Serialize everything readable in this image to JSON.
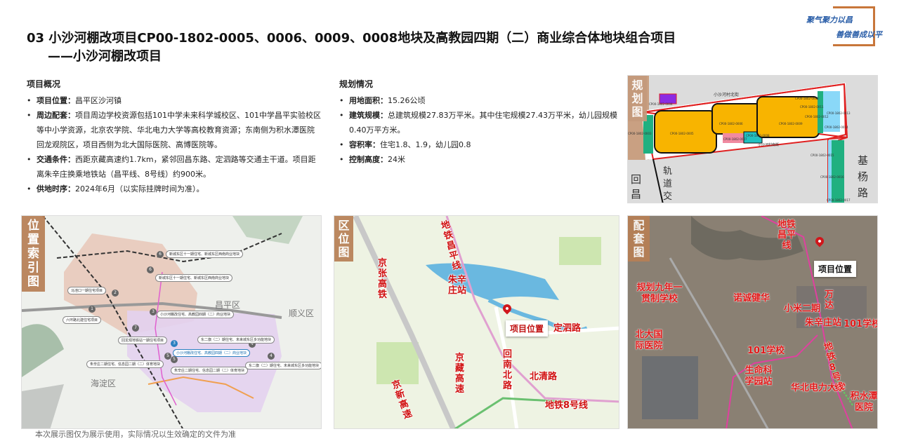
{
  "header": {
    "title_line1": "03 小沙河棚改项目CP00-1802-0005、0006、0009、0008地块及高教园四期（二）商业综合体地块组合项目",
    "title_line2": "——小沙河棚改项目"
  },
  "logo": {
    "line1": "聚气聚力以昌",
    "line2": "善做善成以平",
    "border_color": "#c8763a"
  },
  "overview": {
    "heading": "项目概况",
    "items": [
      {
        "label": "项目位置：",
        "text": "昌平区沙河镇"
      },
      {
        "label": "周边配套：",
        "text": "项目周边学校资源包括101中学未来科学城校区、101中学昌平实验校区等中小学资源，北京农学院、华北电力大学等高校教育资源；东南侧为积水潭医院回龙观院区，项目西侧为北大国际医院、高博医院等。"
      },
      {
        "label": "交通条件：",
        "text": "西距京藏高速约1.7km，紧邻回昌东路、定泗路等交通主干道。项目距离朱辛庄换乘地铁站（昌平线、8号线）约900米。"
      },
      {
        "label": "供地时序：",
        "text": "2024年6月（以实际挂牌时间为准）。"
      }
    ]
  },
  "planning": {
    "heading": "规划情况",
    "items": [
      {
        "label": "用地面积：",
        "text": "15.26公顷"
      },
      {
        "label": "建筑规模：",
        "text": "总建筑规模27.83万平米。其中住宅规模27.43万平米，幼儿园规模0.40万平方米。"
      },
      {
        "label": "容积率：",
        "text": "住宅1.8、1.9，幼儿园0.8"
      },
      {
        "label": "控制高度：",
        "text": "24米"
      }
    ]
  },
  "plan_map": {
    "tag": "规划图",
    "street_north": "小沙河村北街",
    "street_south": "小沙河村南街",
    "road_east": "基杨路",
    "road_west": "回昌",
    "rail": "轨道交",
    "parcels": [
      "CP00-1802-0005",
      "CP00-1802-0006",
      "CP00-1802-0009",
      "CP00-1802-0007",
      "CP00-1802-0008",
      "CP00-1802-0004",
      "CP00-1802-0010",
      "CP00-1802-0011",
      "CP00-1802-0012",
      "CP00-1802-0013",
      "CP00-1802-0014",
      "CP00-1802-0015",
      "CP00-1802-0016",
      "CP00-1802-0017",
      "CP00-1802-0003"
    ]
  },
  "index_map": {
    "tag": "位置索引图",
    "districts": [
      "昌平区",
      "顺义区",
      "海淀区"
    ],
    "labels": [
      {
        "n": "6",
        "text": "新城东区十一期住宅、新城东区西南商业地块"
      },
      {
        "n": "6",
        "text": "新城东区十一期住宅、新城东区西南商业地块"
      },
      {
        "n": "2",
        "text": "马池口一期住宅项目"
      },
      {
        "n": "1",
        "text": "六环路北建住宅项目"
      },
      {
        "n": "3",
        "text": "小沙河棚改住宅、高教园四期（二）商业地块"
      },
      {
        "n": "7",
        "text": "回龙观地铁站一期住宅项目"
      },
      {
        "n": "3",
        "text": "小沙河棚改住宅、高教园四期（二）商业地块"
      },
      {
        "n": "4",
        "text": "东二旗（二）期住宅、未来城东区多功能地块"
      },
      {
        "n": "4",
        "text": "东二旗（二）期住宅、未来城东区多功能地块"
      },
      {
        "n": "5",
        "text": "朱辛庄二期住宅、信息园二期（二）体育地块"
      },
      {
        "n": "5",
        "text": "朱辛庄二期住宅、信息园二期（二）体育地块"
      }
    ]
  },
  "location_map": {
    "tag": "区位图",
    "labels": [
      "地铁昌平线",
      "京张高铁",
      "朱辛庄站",
      "定泗路",
      "京藏高速",
      "回南北路",
      "北清路",
      "京新高速",
      "地铁8号线"
    ],
    "project": "项目位置"
  },
  "facility_map": {
    "tag": "配套图",
    "project": "项目位置",
    "labels": [
      "地铁昌平线",
      "规划九年一贯制学校",
      "诺诚健华",
      "小米二期",
      "万达",
      "朱辛庄站",
      "101学校",
      "北大国际医院",
      "101学校",
      "生命科学园站",
      "华北电力大学",
      "地铁8号线",
      "积水潭医院"
    ]
  },
  "footer_note": "本次展示图仅为展示使用，实际情况以生效确定的文件为准"
}
